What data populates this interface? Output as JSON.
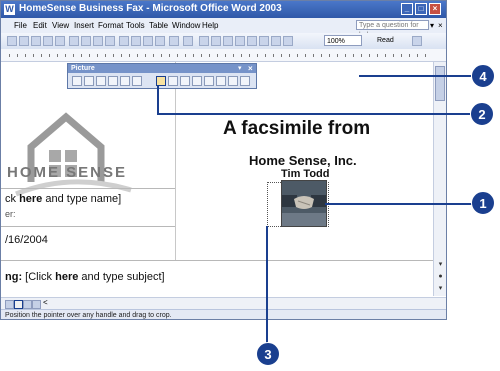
{
  "window": {
    "title": "HomeSense Business Fax - Microsoft Office Word 2003",
    "app_icon": "W",
    "minimize": "_",
    "restore": "□",
    "close": "×"
  },
  "menu": {
    "items": [
      "File",
      "Edit",
      "View",
      "Insert",
      "Format",
      "Tools",
      "Table",
      "Window",
      "Help"
    ],
    "help_placeholder": "Type a question for help",
    "help_dropdown": "▾",
    "doc_close": "×"
  },
  "toolbar": {
    "zoom": "100%",
    "read_label": "Read"
  },
  "picture_toolbar": {
    "title": "Picture",
    "dropdown": "▾",
    "close": "×"
  },
  "document": {
    "logo_text": "HOME SENSE",
    "heading": "A facsimile from",
    "company": "Home Sense, Inc.",
    "person": "Tim Todd",
    "to_line_prefix": "ck ",
    "to_line_bold": "here",
    "to_line_suffix": " and type name]",
    "er_label": "er:",
    "date": "/16/2004",
    "subject_prefix": "ng: ",
    "subject_bracket": "[Click ",
    "subject_bold": "here",
    "subject_suffix": " and type subject]"
  },
  "status_bar": {
    "text": "Position the pointer over any handle and drag to crop."
  },
  "callouts": [
    "1",
    "2",
    "3",
    "4"
  ],
  "colors": {
    "title_bar": "#2f58a8",
    "callout": "#1a3f8f"
  }
}
